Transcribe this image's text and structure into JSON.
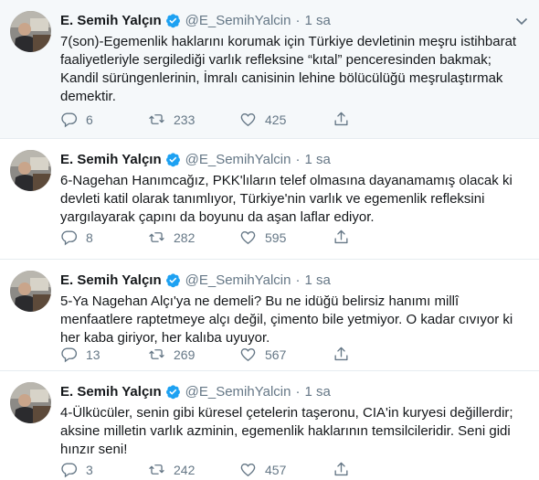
{
  "colors": {
    "accent": "#1da1f2",
    "muted": "#657786",
    "text": "#14171a",
    "divider": "#e6ecf0"
  },
  "icons": {
    "reply": "reply-icon",
    "retweet": "retweet-icon",
    "like": "heart-icon",
    "share": "share-icon",
    "verified": "verified-badge-icon",
    "menu": "chevron-down-icon"
  },
  "tweets": [
    {
      "name": "E. Semih Yalçın",
      "handle": "@E_SemihYalcin",
      "dot": "·",
      "time": "1 sa",
      "lines": [
        "7(son)-Egemenlik haklarını korumak için Türkiye devletinin meşru istihbarat",
        "faaliyetleriyle sergilediği varlık refleksine “kıtal” penceresinden bakmak;",
        "Kandil sürüngenlerinin, İmralı canisinin lehine bölücülüğü meşrulaştırmak",
        "demektir."
      ],
      "replies": "6",
      "retweets": "233",
      "likes": "425"
    },
    {
      "name": "E. Semih Yalçın",
      "handle": "@E_SemihYalcin",
      "dot": "·",
      "time": "1 sa",
      "lines": [
        "6-Nagehan Hanımcağız, PKK'lıların telef olmasına dayanamamış olacak ki",
        "devleti katil olarak tanımlıyor, Türkiye'nin varlık ve egemenlik refleksini",
        "yargılayarak çapını da boyunu da aşan laflar ediyor."
      ],
      "replies": "8",
      "retweets": "282",
      "likes": "595"
    },
    {
      "name": "E. Semih Yalçın",
      "handle": "@E_SemihYalcin",
      "dot": "·",
      "time": "1 sa",
      "lines": [
        "5-Ya Nagehan Alçı'ya ne demeli? Bu ne idüğü belirsiz hanımı millî",
        "menfaatlere raptetmeye alçı değil, çimento bile yetmiyor. O kadar cıvıyor ki",
        "her kaba giriyor, her kalıba uyuyor."
      ],
      "replies": "13",
      "retweets": "269",
      "likes": "567"
    },
    {
      "name": "E. Semih Yalçın",
      "handle": "@E_SemihYalcin",
      "dot": "·",
      "time": "1 sa",
      "lines": [
        "4-Ülkücüler, senin gibi küresel çetelerin taşeronu, CIA'in kuryesi değillerdir;",
        "aksine milletin varlık azminin, egemenlik haklarının temsilcileridir. Seni gidi",
        "hınzır seni!"
      ],
      "replies": "3",
      "retweets": "242",
      "likes": "457"
    }
  ]
}
